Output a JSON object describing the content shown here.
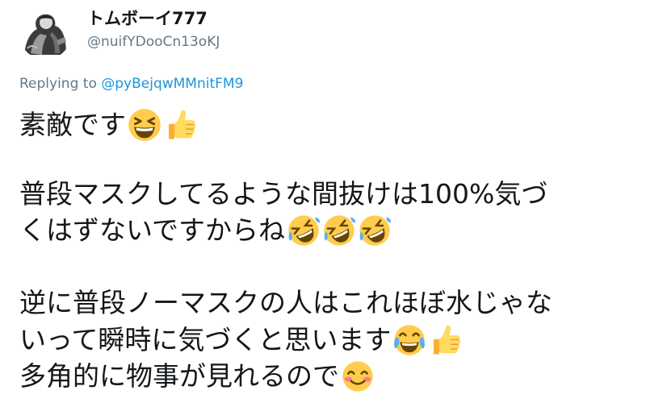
{
  "tweet": {
    "display_name": "トムボーイ777",
    "handle": "@nuifYDooCn13oKJ",
    "replying_prefix": "Replying to",
    "replying_to": "@pyBejqwMMnitFM9",
    "lines": [
      {
        "text": "素敵です",
        "emojis": [
          "grinning-squinting-face-icon",
          "thumbs-up-icon"
        ]
      },
      {
        "text": "普段マスクしてるような間抜けは100%気づ",
        "emojis": []
      },
      {
        "text": "くはずないですからね",
        "emojis": [
          "rolling-on-floor-laughing-icon",
          "rolling-on-floor-laughing-icon",
          "rolling-on-floor-laughing-icon"
        ]
      },
      {
        "text": "逆に普段ノーマスクの人はこれほぼ水じゃな",
        "emojis": []
      },
      {
        "text": "いって瞬時に気づくと思います",
        "emojis": [
          "face-with-tears-of-joy-icon",
          "thumbs-up-icon"
        ]
      },
      {
        "text": "多角的に物事が見れるので",
        "emojis": [
          "smiling-face-with-smiling-eyes-icon"
        ]
      }
    ]
  },
  "colors": {
    "name": "#14171a",
    "secondary": "#657786",
    "link": "#1b95e0",
    "emoji_yellow": "#ffcc4d",
    "thumb_yellow": "#ffdc5d"
  }
}
